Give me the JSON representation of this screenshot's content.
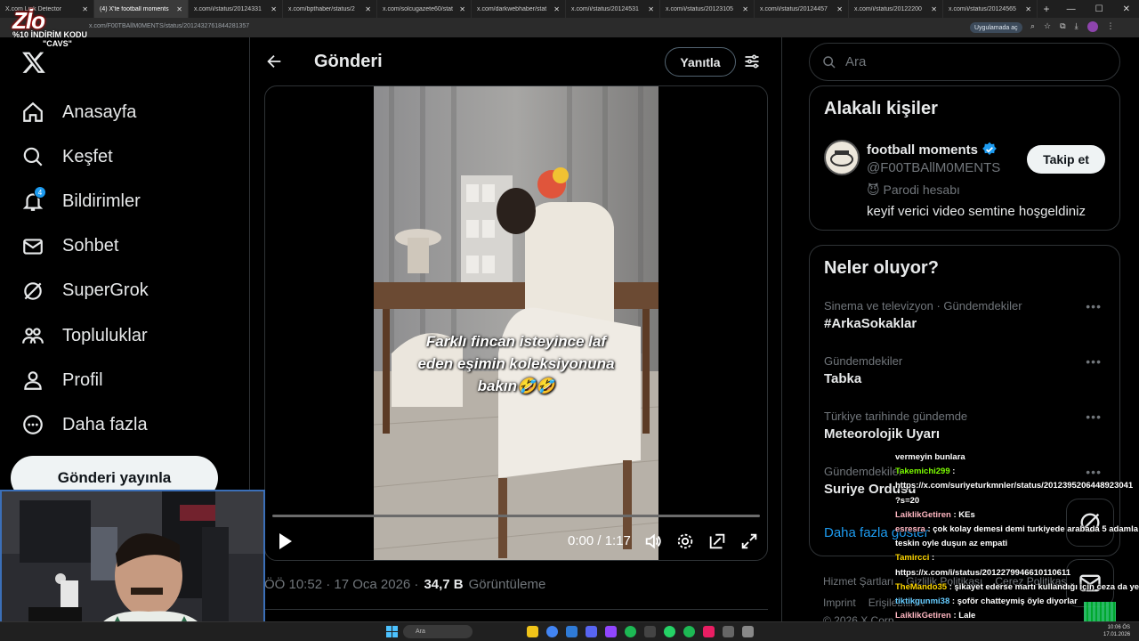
{
  "browser": {
    "tabs": [
      {
        "label": "X.com Link Detector",
        "active": false
      },
      {
        "label": "(4) X'te football moments",
        "active": true
      },
      {
        "label": "x.com/i/status/20124331",
        "active": false
      },
      {
        "label": "x.com/bpthaber/status/2",
        "active": false
      },
      {
        "label": "x.com/solcugazete60/stat",
        "active": false
      },
      {
        "label": "x.com/darkwebhaber/stat",
        "active": false
      },
      {
        "label": "x.com/i/status/20124531",
        "active": false
      },
      {
        "label": "x.com/i/status/20123105",
        "active": false
      },
      {
        "label": "x.com/i/status/20124457",
        "active": false
      },
      {
        "label": "x.com/i/status/20122200",
        "active": false
      },
      {
        "label": "x.com/i/status/20124565",
        "active": false
      }
    ],
    "url": "x.com/F00TBAllM0MENTS/status/2012432761844281357",
    "app_chip": "Uygulamada aç",
    "accent": "#1d9bf0"
  },
  "overlay_logo": {
    "big": "Zİo",
    "promo": "%10 İNDİRİM KODU",
    "code": "\"CAVS\"",
    "small": "COM"
  },
  "sidebar": {
    "nav": [
      {
        "label": "Anasayfa",
        "icon": "home-icon"
      },
      {
        "label": "Keşfet",
        "icon": "search-icon"
      },
      {
        "label": "Bildirimler",
        "icon": "bell-icon",
        "badge": "4"
      },
      {
        "label": "Sohbet",
        "icon": "mail-icon"
      },
      {
        "label": "SuperGrok",
        "icon": "grok-icon"
      },
      {
        "label": "Topluluklar",
        "icon": "communities-icon"
      },
      {
        "label": "Profil",
        "icon": "profile-icon"
      },
      {
        "label": "Daha fazla",
        "icon": "more-icon"
      }
    ],
    "post_button": "Gönderi yayınla"
  },
  "main": {
    "title": "Gönderi",
    "reply_button": "Yanıtla",
    "video": {
      "caption_lines": [
        "Farklı fincan isteyince laf",
        "eden eşimin koleksiyonuna",
        "bakın🤣🤣"
      ],
      "time": "0:00 / 1:17",
      "progress": 0
    },
    "meta": {
      "time": "ÖÖ 10:52 · 17 Oca 2026 ·",
      "views": "34,7 B",
      "views_label": "Görüntüleme"
    }
  },
  "right": {
    "search_placeholder": "Ara",
    "related": {
      "title": "Alakalı kişiler",
      "name": "football moments",
      "handle": "@F00TBAllM0MENTS",
      "parody": "Parodi hesabı",
      "bio": "keyif verici video semtine hoşgeldiniz",
      "follow": "Takip et"
    },
    "trends": {
      "title": "Neler oluyor?",
      "items": [
        {
          "context": "Sinema ve televizyon · Gündemdekiler",
          "name": "#ArkaSokaklar"
        },
        {
          "context": "Gündemdekiler",
          "name": "Tabka"
        },
        {
          "context": "Türkiye tarihinde gündemde",
          "name": "Meteorolojik Uyarı"
        },
        {
          "context": "Gündemdekiler",
          "name": "Suriye Ordusu"
        }
      ],
      "show_more": "Daha fazla göster"
    },
    "footer": {
      "row1": [
        "Hizmet Şartları",
        "Gizlilik Politikası",
        "Çerez Politikası"
      ],
      "row2": [
        "Imprint",
        "Erişilebilirlik"
      ],
      "row3": "© 2026 X Corp."
    }
  },
  "chat": [
    {
      "user": "",
      "text": "vermeyin bunlara"
    },
    {
      "user": "Takemichi299",
      "text": ":",
      "cls": "u1"
    },
    {
      "user": "",
      "text": "https://x.com/suriyeturkmnler/status/2012395206448923041"
    },
    {
      "user": "",
      "text": "?s=20"
    },
    {
      "user": "LaikIikGetiren",
      "text": ": KEs",
      "cls": "u2"
    },
    {
      "user": "esresra",
      "text": ": çok kolay demesi demi turkiyede arabada 5 adamla",
      "cls": "u2"
    },
    {
      "user": "",
      "text": "teskin oyle duşun az empati"
    },
    {
      "user": "Tamircci",
      "text": ":",
      "cls": "u3"
    },
    {
      "user": "",
      "text": "https://x.com/i/status/2012279946610110611"
    },
    {
      "user": "TheMando35",
      "text": ": şikayet ederse martı kullandığı için ceza da yer",
      "cls": "u3"
    },
    {
      "user": "tiktikgunmi38",
      "text": ": şoför chatteymiş öyle diyorlar",
      "cls": "u4"
    },
    {
      "user": "LaikIikGetiren",
      "text": ": Lale",
      "cls": "u2"
    }
  ],
  "taskbar": {
    "search": "Ara",
    "time": "10:06 ÖS",
    "date": "17.01.2026"
  }
}
